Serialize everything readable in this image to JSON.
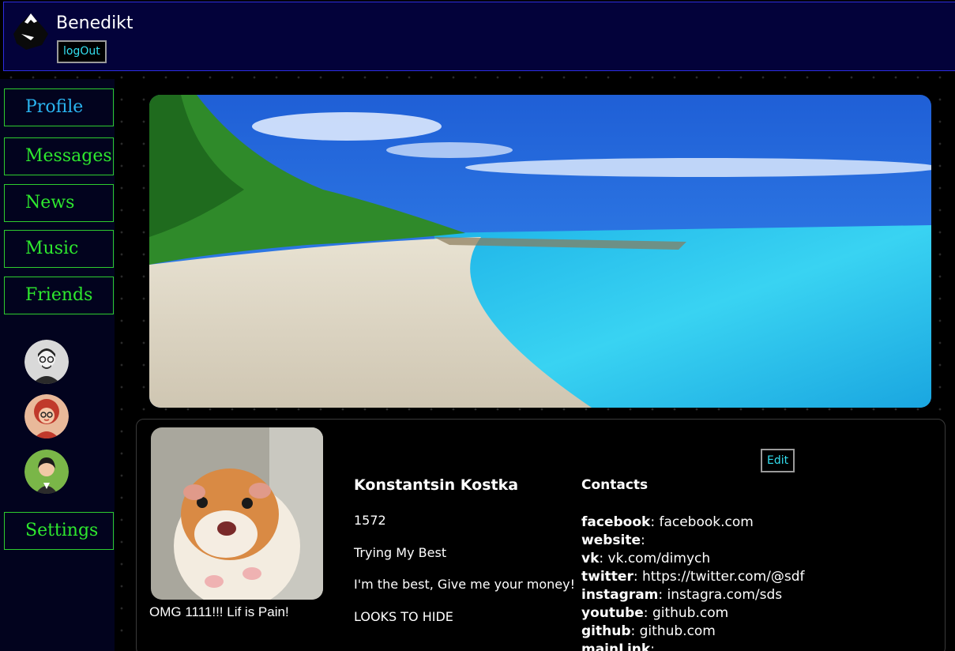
{
  "header": {
    "username": "Benedikt",
    "logout_label": "logOut"
  },
  "sidebar": {
    "items": [
      {
        "label": "Profile"
      },
      {
        "label": "Messages"
      },
      {
        "label": "News"
      },
      {
        "label": "Music"
      },
      {
        "label": "Friends"
      }
    ],
    "settings_label": "Settings"
  },
  "profile": {
    "full_name": "Konstantsin Kostka",
    "user_id": "1572",
    "looking_for_job_description": "Trying My Best",
    "about_me": "I'm the best, Give me your money!",
    "job_status": "LOOKS TO HIDE",
    "status": "OMG 1111!!! Lif is Pain!",
    "edit_label": "Edit",
    "contacts_title": "Contacts",
    "contacts": [
      {
        "key": "facebook",
        "value": "facebook.com"
      },
      {
        "key": "website",
        "value": ""
      },
      {
        "key": "vk",
        "value": "vk.com/dimych"
      },
      {
        "key": "twitter",
        "value": "https://twitter.com/@sdf"
      },
      {
        "key": "instagram",
        "value": "instagra.com/sds"
      },
      {
        "key": "youtube",
        "value": "github.com"
      },
      {
        "key": "github",
        "value": "github.com"
      },
      {
        "key": "mainLink",
        "value": ""
      }
    ]
  },
  "colors": {
    "header_bg": "#03023a",
    "nav_border": "#2ecc2e",
    "nav_active": "#2ab4f0",
    "nav_text": "#2ee82e",
    "button_text": "#33e0f0"
  }
}
